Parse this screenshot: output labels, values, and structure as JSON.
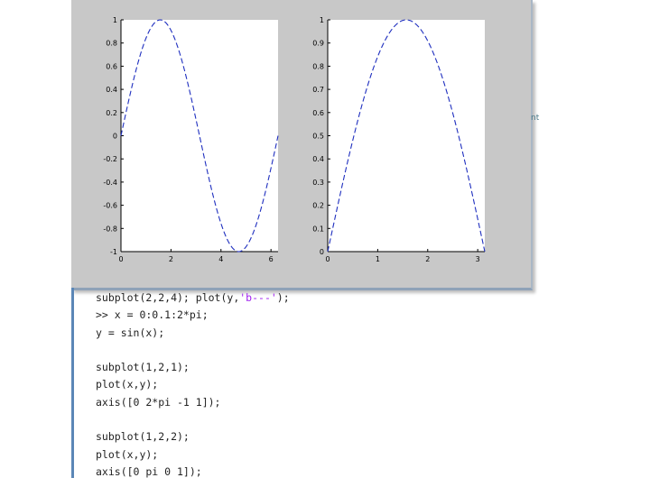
{
  "figure": {
    "plots": [
      {
        "id": "left",
        "xlim": [
          0,
          6.283
        ],
        "ylim": [
          -1,
          1
        ],
        "xticks": [
          "0",
          "2",
          "4",
          "6"
        ],
        "xtick_values": [
          0,
          2,
          4,
          6
        ],
        "yticks": [
          "1",
          "0.8",
          "0.6",
          "0.4",
          "0.2",
          "0",
          "-0.2",
          "-0.4",
          "-0.6",
          "-0.8",
          "-1"
        ],
        "ytick_values": [
          1,
          0.8,
          0.6,
          0.4,
          0.2,
          0,
          -0.2,
          -0.4,
          -0.6,
          -0.8,
          -1
        ],
        "series_color": "#1f2fbf"
      },
      {
        "id": "right",
        "xlim": [
          0,
          3.1416
        ],
        "ylim": [
          0,
          1
        ],
        "xticks": [
          "0",
          "1",
          "2",
          "3"
        ],
        "xtick_values": [
          0,
          1,
          2,
          3
        ],
        "yticks": [
          "1",
          "0.9",
          "0.8",
          "0.7",
          "0.6",
          "0.5",
          "0.4",
          "0.3",
          "0.2",
          "0.1",
          "0"
        ],
        "ytick_values": [
          1,
          0.9,
          0.8,
          0.7,
          0.6,
          0.5,
          0.4,
          0.3,
          0.2,
          0.1,
          0
        ],
        "series_color": "#1f2fbf"
      }
    ]
  },
  "chart_data": [
    {
      "type": "line",
      "function": "sin(x)",
      "x": [
        0,
        0.5,
        1,
        1.5,
        2,
        2.5,
        3,
        3.5,
        4,
        4.5,
        5,
        5.5,
        6,
        6.2
      ],
      "y": [
        0,
        0.479,
        0.841,
        0.997,
        0.909,
        0.598,
        0.141,
        -0.351,
        -0.757,
        -0.978,
        -0.959,
        -0.706,
        -0.279,
        -0.083
      ],
      "xlim": [
        0,
        6.283
      ],
      "ylim": [
        -1,
        1
      ],
      "line_style": "dashed"
    },
    {
      "type": "line",
      "function": "sin(x)",
      "x": [
        0,
        0.5,
        1,
        1.5,
        2,
        2.5,
        3,
        3.1
      ],
      "y": [
        0,
        0.479,
        0.841,
        0.997,
        0.909,
        0.598,
        0.141,
        0.042
      ],
      "xlim": [
        0,
        3.1416
      ],
      "ylim": [
        0,
        1
      ],
      "line_style": "dashed"
    }
  ],
  "command_window": {
    "lines": [
      {
        "pre": "subplot(2,2,4); plot(y,",
        "str": "'b---'",
        "post": ");"
      },
      {
        "pre": ">> x = 0:0.1:2*pi;"
      },
      {
        "pre": "y = sin(x);"
      },
      {
        "pre": ""
      },
      {
        "pre": "subplot(1,2,1);"
      },
      {
        "pre": "plot(x,y);"
      },
      {
        "pre": "axis([0 2*pi -1 1]);"
      },
      {
        "pre": ""
      },
      {
        "pre": "subplot(1,2,2);"
      },
      {
        "pre": "plot(x,y);"
      },
      {
        "pre": "axis([0 pi 0 1]);"
      }
    ]
  },
  "side_text": "nt"
}
